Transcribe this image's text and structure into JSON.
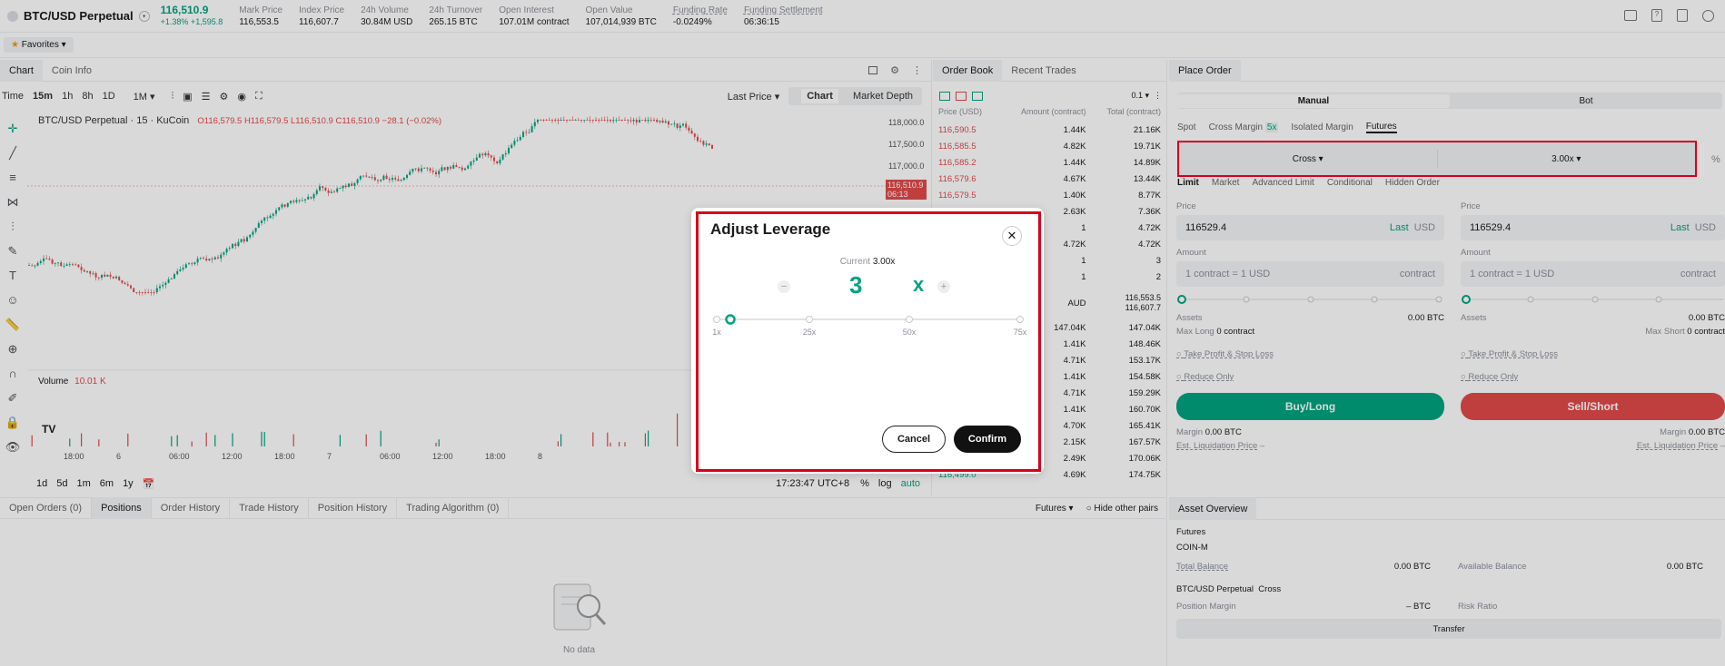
{
  "header": {
    "symbol": "BTC/USD Perpetual",
    "last_price": "116,510.9",
    "change_pct": "+1.38%",
    "change_abs": "+1,595.8",
    "stats": [
      {
        "label": "Mark Price",
        "value": "116,553.5"
      },
      {
        "label": "Index Price",
        "value": "116,607.7"
      },
      {
        "label": "24h Volume",
        "value": "30.84M USD"
      },
      {
        "label": "24h Turnover",
        "value": "265.15 BTC"
      },
      {
        "label": "Open Interest",
        "value": "107.01M contract"
      },
      {
        "label": "Open Value",
        "value": "107,014,939 BTC"
      },
      {
        "label": "Funding Rate",
        "value": "-0.0249%"
      },
      {
        "label": "Funding Settlement",
        "value": "06:36:15"
      }
    ],
    "favorites_label": "Favorites"
  },
  "chart_panel": {
    "tabs": [
      "Chart",
      "Coin Info"
    ],
    "time_label": "Time",
    "intervals": [
      "15m",
      "1h",
      "8h",
      "1D",
      "1M"
    ],
    "active_interval": "15m",
    "price_type": "Last Price",
    "view_tabs": [
      "Chart",
      "Market Depth"
    ],
    "legend": "BTC/USD Perpetual · 15 · KuCoin",
    "ohlc": "O116,579.5 H116,579.5 L116,510.9 C116,510.9 −28.1 (−0.02%)",
    "volume_label": "Volume",
    "volume_value": "10.01 K",
    "price_ticks": [
      "118,000.0",
      "117,500.0",
      "117,000.0"
    ],
    "current_price_tag": "116,510.9",
    "current_price_time": "06:13",
    "time_ticks": [
      "18:00",
      "6",
      "06:00",
      "12:00",
      "18:00",
      "7",
      "06:00",
      "12:00",
      "18:00",
      "8"
    ],
    "ranges": [
      "1d",
      "5d",
      "1m",
      "6m",
      "1y"
    ],
    "clock": "17:23:47 UTC+8",
    "scale_opts": [
      "%",
      "log",
      "auto"
    ]
  },
  "order_book": {
    "tabs": [
      "Order Book",
      "Recent Trades"
    ],
    "precision": "0.1",
    "columns": [
      "Price (USD)",
      "Amount (contract)",
      "Total (contract)"
    ],
    "asks": [
      [
        "116,590.5",
        "1.44K",
        "21.16K"
      ],
      [
        "116,585.5",
        "4.82K",
        "19.71K"
      ],
      [
        "116,585.2",
        "1.44K",
        "14.89K"
      ],
      [
        "116,579.6",
        "4.67K",
        "13.44K"
      ],
      [
        "116,579.5",
        "1.40K",
        "8.77K"
      ],
      [
        "",
        "2.63K",
        "7.36K"
      ],
      [
        "",
        "1",
        "4.72K"
      ],
      [
        "",
        "4.72K",
        "4.72K"
      ],
      [
        "",
        "1",
        "3"
      ],
      [
        "",
        "1",
        "2"
      ]
    ],
    "mid_label": "AUD",
    "mid_prices": [
      "116,553.5",
      "116,607.7"
    ],
    "bids": [
      [
        "",
        "147.04K",
        "147.04K"
      ],
      [
        "",
        "1.41K",
        "148.46K"
      ],
      [
        "",
        "4.71K",
        "153.17K"
      ],
      [
        "",
        "1.41K",
        "154.58K"
      ],
      [
        "",
        "4.71K",
        "159.29K"
      ],
      [
        "",
        "1.41K",
        "160.70K"
      ],
      [
        "",
        "4.70K",
        "165.41K"
      ],
      [
        "",
        "2.15K",
        "167.57K"
      ],
      [
        "",
        "2.49K",
        "170.06K"
      ],
      [
        "116,499.0",
        "4.69K",
        "174.75K"
      ]
    ]
  },
  "place_order": {
    "title": "Place Order",
    "modes": [
      "Manual",
      "Bot"
    ],
    "markets": [
      "Spot",
      "Cross Margin",
      "Isolated Margin",
      "Futures"
    ],
    "cross_badge": "5x",
    "margin_mode": "Cross",
    "leverage": "3.00x",
    "order_types": [
      "Limit",
      "Market",
      "Advanced Limit",
      "Conditional",
      "Hidden Order"
    ],
    "price_label": "Price",
    "price_value": "116529.4",
    "last_label": "Last",
    "currency": "USD",
    "amount_label": "Amount",
    "amount_placeholder": "1 contract = 1 USD",
    "amount_unit": "contract",
    "assets_label": "Assets",
    "assets_value": "0.00",
    "assets_unit": "BTC",
    "max_long": "Max Long",
    "max_long_val": "0 contract",
    "max_short": "Max Short",
    "max_short_val": "0 contract",
    "tpsl": "Take Profit & Stop Loss",
    "reduce_only": "Reduce Only",
    "buy_label": "Buy/Long",
    "sell_label": "Sell/Short",
    "margin_label": "Margin",
    "margin_value": "0.00 BTC",
    "liq_label": "Est. Liquidation Price",
    "liq_value": "–"
  },
  "bottom": {
    "tabs": [
      "Open Orders (0)",
      "Positions",
      "Order History",
      "Trade History",
      "Position History",
      "Trading Algorithm (0)"
    ],
    "active_tab": "Positions",
    "filter": "Futures",
    "hide_pairs": "Hide other pairs",
    "empty": "No data"
  },
  "asset_overview": {
    "title": "Asset Overview",
    "section": "Futures",
    "sub": "COIN-M",
    "total_balance_label": "Total Balance",
    "total_balance": "0.00 BTC",
    "available_label": "Available Balance",
    "available": "0.00 BTC",
    "pair": "BTC/USD Perpetual",
    "pair_mode": "Cross",
    "position_margin_label": "Position Margin",
    "position_margin": "– BTC",
    "risk_label": "Risk Ratio",
    "transfer": "Transfer"
  },
  "modal": {
    "title": "Adjust Leverage",
    "current_label": "Current",
    "current_value": "3.00x",
    "leverage_value": "3",
    "leverage_suffix": "x",
    "slider_marks": [
      "1x",
      "25x",
      "50x",
      "75x"
    ],
    "slider_value": 3,
    "slider_max": 75,
    "cancel": "Cancel",
    "confirm": "Confirm"
  }
}
